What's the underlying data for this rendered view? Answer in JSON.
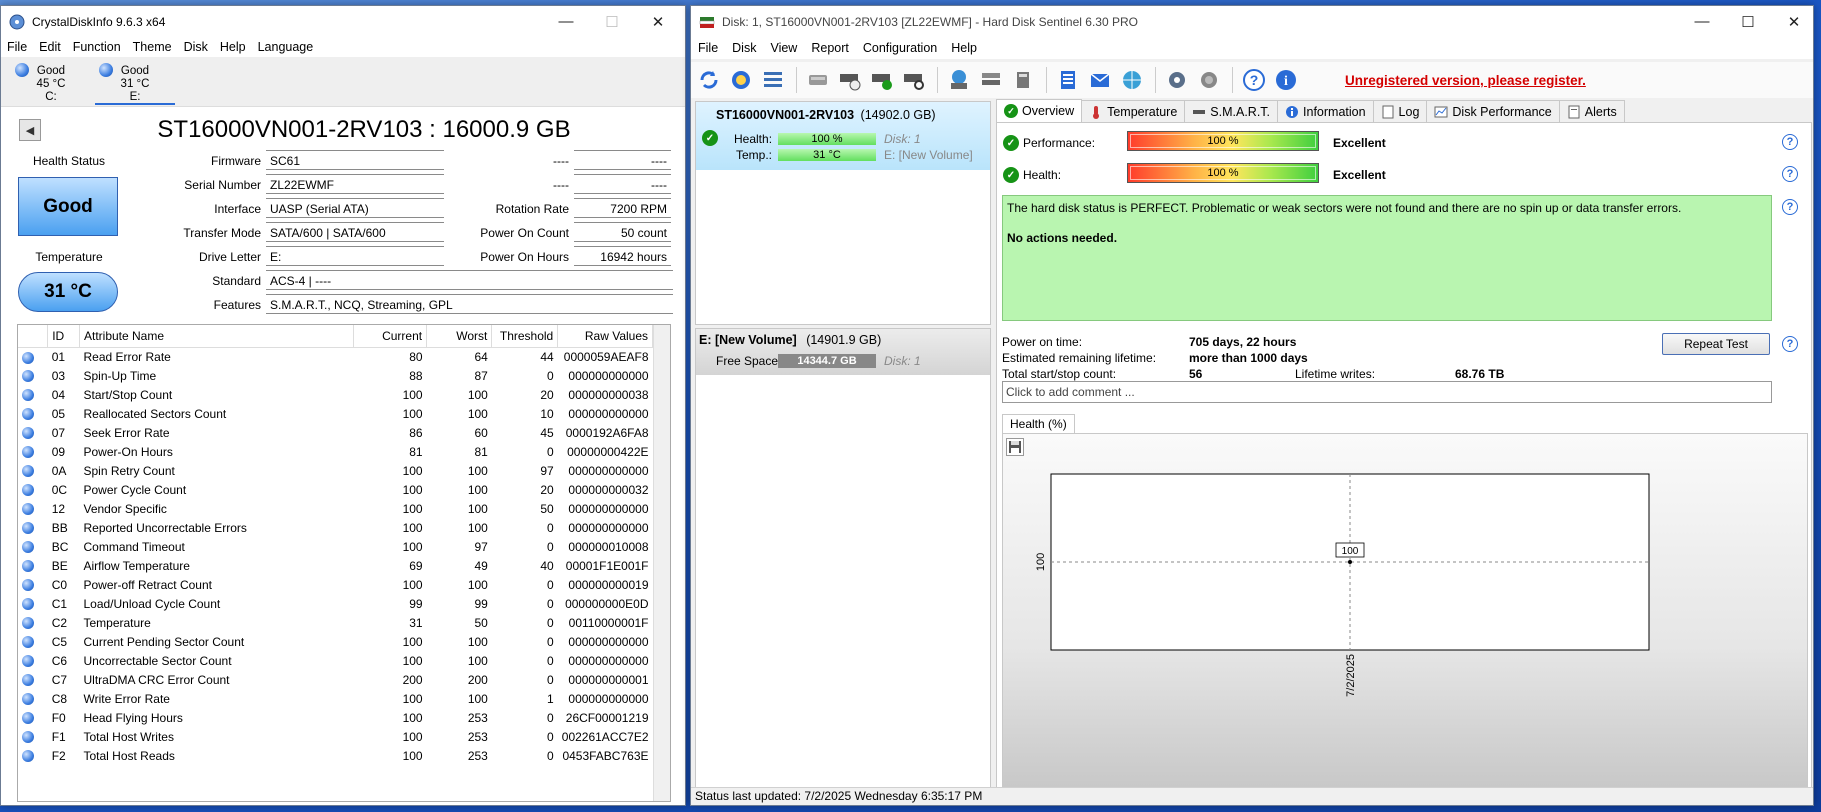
{
  "cdi": {
    "title": "CrystalDiskInfo 9.6.3 x64",
    "menu": [
      "File",
      "Edit",
      "Function",
      "Theme",
      "Disk",
      "Help",
      "Language"
    ],
    "drives": [
      {
        "status": "Good",
        "temp": "45 °C",
        "letter": "C:"
      },
      {
        "status": "Good",
        "temp": "31 °C",
        "letter": "E:"
      }
    ],
    "model": "ST16000VN001-2RV103 : 16000.9 GB",
    "health_status_label": "Health Status",
    "health_status": "Good",
    "temperature_label": "Temperature",
    "temperature": "31 °C",
    "fields": {
      "firmware_label": "Firmware",
      "firmware": "SC61",
      "serial_label": "Serial Number",
      "serial": "ZL22EWMF",
      "interface_label": "Interface",
      "interface": "UASP (Serial ATA)",
      "transfer_label": "Transfer Mode",
      "transfer": "SATA/600 | SATA/600",
      "letter_label": "Drive Letter",
      "letter": "E:",
      "standard_label": "Standard",
      "standard": "ACS-4 | ----",
      "features_label": "Features",
      "features": "S.M.A.R.T., NCQ, Streaming, GPL",
      "dash1_label": "----",
      "dash1": "----",
      "dash2_label": "----",
      "dash2": "----",
      "rotation_label": "Rotation Rate",
      "rotation": "7200 RPM",
      "power_count_label": "Power On Count",
      "power_count": "50 count",
      "power_hours_label": "Power On Hours",
      "power_hours": "16942 hours"
    },
    "columns": [
      "ID",
      "Attribute Name",
      "Current",
      "Worst",
      "Threshold",
      "Raw Values"
    ],
    "rows": [
      [
        "01",
        "Read Error Rate",
        "80",
        "64",
        "44",
        "0000059AEAF8"
      ],
      [
        "03",
        "Spin-Up Time",
        "88",
        "87",
        "0",
        "000000000000"
      ],
      [
        "04",
        "Start/Stop Count",
        "100",
        "100",
        "20",
        "000000000038"
      ],
      [
        "05",
        "Reallocated Sectors Count",
        "100",
        "100",
        "10",
        "000000000000"
      ],
      [
        "07",
        "Seek Error Rate",
        "86",
        "60",
        "45",
        "0000192A6FA8"
      ],
      [
        "09",
        "Power-On Hours",
        "81",
        "81",
        "0",
        "00000000422E"
      ],
      [
        "0A",
        "Spin Retry Count",
        "100",
        "100",
        "97",
        "000000000000"
      ],
      [
        "0C",
        "Power Cycle Count",
        "100",
        "100",
        "20",
        "000000000032"
      ],
      [
        "12",
        "Vendor Specific",
        "100",
        "100",
        "50",
        "000000000000"
      ],
      [
        "BB",
        "Reported Uncorrectable Errors",
        "100",
        "100",
        "0",
        "000000000000"
      ],
      [
        "BC",
        "Command Timeout",
        "100",
        "97",
        "0",
        "000000010008"
      ],
      [
        "BE",
        "Airflow Temperature",
        "69",
        "49",
        "40",
        "00001F1E001F"
      ],
      [
        "C0",
        "Power-off Retract Count",
        "100",
        "100",
        "0",
        "000000000019"
      ],
      [
        "C1",
        "Load/Unload Cycle Count",
        "99",
        "99",
        "0",
        "000000000E0D"
      ],
      [
        "C2",
        "Temperature",
        "31",
        "50",
        "0",
        "00110000001F"
      ],
      [
        "C5",
        "Current Pending Sector Count",
        "100",
        "100",
        "0",
        "000000000000"
      ],
      [
        "C6",
        "Uncorrectable Sector Count",
        "100",
        "100",
        "0",
        "000000000000"
      ],
      [
        "C7",
        "UltraDMA CRC Error Count",
        "200",
        "200",
        "0",
        "000000000001"
      ],
      [
        "C8",
        "Write Error Rate",
        "100",
        "100",
        "1",
        "000000000000"
      ],
      [
        "F0",
        "Head Flying Hours",
        "100",
        "253",
        "0",
        "26CF00001219"
      ],
      [
        "F1",
        "Total Host Writes",
        "100",
        "253",
        "0",
        "002261ACC7E2"
      ],
      [
        "F2",
        "Total Host Reads",
        "100",
        "253",
        "0",
        "0453FABC763E"
      ]
    ]
  },
  "hds": {
    "title": "Disk: 1, ST16000VN001-2RV103 [ZL22EWMF]  -  Hard Disk Sentinel 6.30 PRO",
    "menu": [
      "File",
      "Disk",
      "View",
      "Report",
      "Configuration",
      "Help"
    ],
    "unregistered": "Unregistered version, please register.",
    "disk": {
      "name": "ST16000VN001-2RV103",
      "size": "(14902.0 GB)",
      "health_label": "Health:",
      "health": "100 %",
      "health_fill": 1.0,
      "disk_no": "Disk: 1",
      "temp_label": "Temp.:",
      "temp": "31 °C",
      "temp_fill": 1.0,
      "volume_ref": "E: [New Volume]"
    },
    "volume": {
      "name": "E: [New Volume]",
      "size": "(14901.9 GB)",
      "free_label": "Free Space",
      "free": "14344.7 GB",
      "free_fill": 1.0,
      "disk_no": "Disk: 1"
    },
    "tabs": [
      "Overview",
      "Temperature",
      "S.M.A.R.T.",
      "Information",
      "Log",
      "Disk Performance",
      "Alerts"
    ],
    "overview": {
      "performance_label": "Performance:",
      "performance": "100 %",
      "performance_text": "Excellent",
      "health_label": "Health:",
      "health": "100 %",
      "health_text": "Excellent",
      "status_line1": "The hard disk status is PERFECT. Problematic or weak sectors were not found and there are no spin up or data transfer errors.",
      "status_line2": "No actions needed.",
      "power_on_label": "Power on time:",
      "power_on": "705 days, 22 hours",
      "lifetime_label": "Estimated remaining lifetime:",
      "lifetime": "more than 1000 days",
      "startstop_label": "Total start/stop count:",
      "startstop": "56",
      "writes_label": "Lifetime writes:",
      "writes": "68.76 TB",
      "repeat_test": "Repeat Test",
      "comment_placeholder": "Click to add comment ...",
      "health_tab": "Health (%)"
    },
    "chart_data": {
      "type": "line",
      "title": "",
      "xlabel": "",
      "ylabel": "",
      "x": [
        "7/2/2025"
      ],
      "series": [
        {
          "values": [
            100
          ]
        }
      ],
      "y_tick_labels": [
        "100"
      ],
      "x_tick_labels": [
        "7/2/2025"
      ],
      "data_labels": [
        "100"
      ]
    },
    "status_bar": "Status last updated: 7/2/2025 Wednesday 6:35:17 PM"
  }
}
